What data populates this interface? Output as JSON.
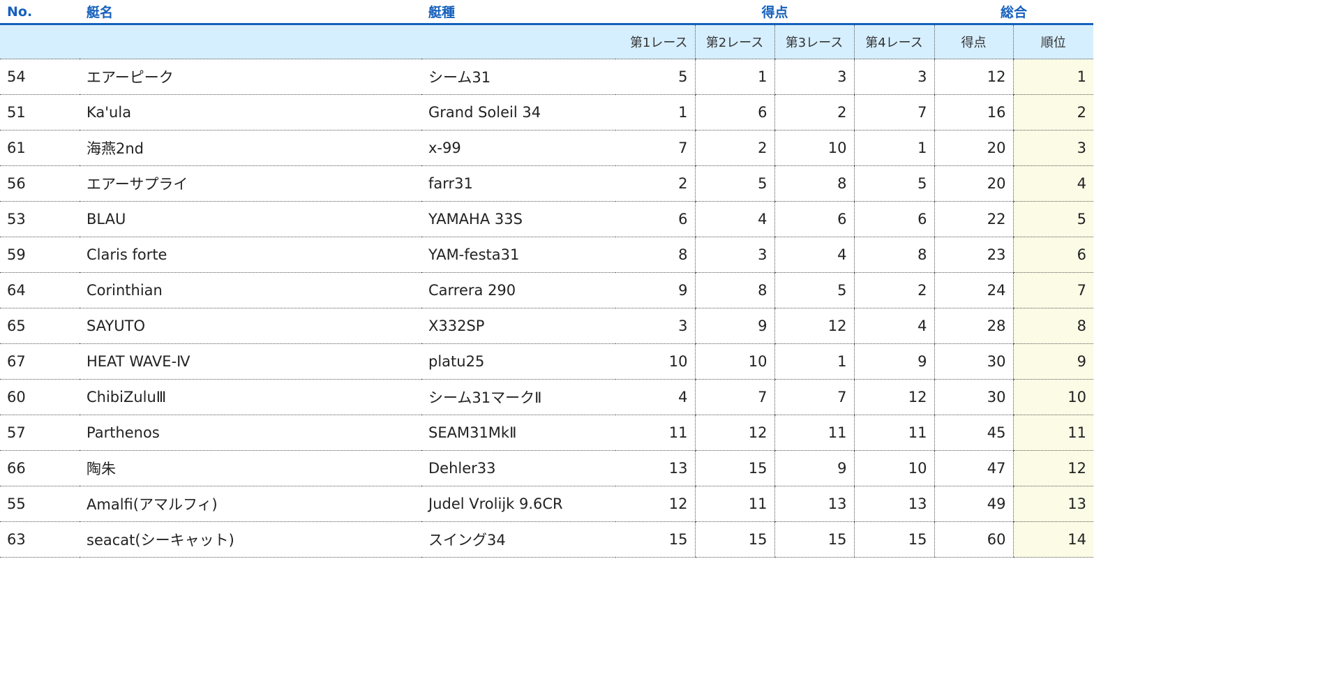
{
  "table": {
    "group_headers": {
      "no": "No.",
      "boat_name": "艇名",
      "boat_type": "艇種",
      "score": "得点",
      "overall": "総合"
    },
    "sub_headers": {
      "race1": "第1レース",
      "race2": "第2レース",
      "race3": "第3レース",
      "race4": "第4レース",
      "points": "得点",
      "rank": "順位"
    },
    "rows": [
      {
        "no": "54",
        "name": "エアーピーク",
        "type": "シーム31",
        "r1": "5",
        "r2": "1",
        "r3": "3",
        "r4": "3",
        "points": "12",
        "rank": "1"
      },
      {
        "no": "51",
        "name": "Ka'ula",
        "type": "Grand Soleil 34",
        "r1": "1",
        "r2": "6",
        "r3": "2",
        "r4": "7",
        "points": "16",
        "rank": "2"
      },
      {
        "no": "61",
        "name": "海燕2nd",
        "type": "x-99",
        "r1": "7",
        "r2": "2",
        "r3": "10",
        "r4": "1",
        "points": "20",
        "rank": "3"
      },
      {
        "no": "56",
        "name": "エアーサプライ",
        "type": "farr31",
        "r1": "2",
        "r2": "5",
        "r3": "8",
        "r4": "5",
        "points": "20",
        "rank": "4"
      },
      {
        "no": "53",
        "name": "BLAU",
        "type": "YAMAHA 33S",
        "r1": "6",
        "r2": "4",
        "r3": "6",
        "r4": "6",
        "points": "22",
        "rank": "5"
      },
      {
        "no": "59",
        "name": "Claris forte",
        "type": "YAM-festa31",
        "r1": "8",
        "r2": "3",
        "r3": "4",
        "r4": "8",
        "points": "23",
        "rank": "6"
      },
      {
        "no": "64",
        "name": "Corinthian",
        "type": "Carrera 290",
        "r1": "9",
        "r2": "8",
        "r3": "5",
        "r4": "2",
        "points": "24",
        "rank": "7"
      },
      {
        "no": "65",
        "name": "SAYUTO",
        "type": "X332SP",
        "r1": "3",
        "r2": "9",
        "r3": "12",
        "r4": "4",
        "points": "28",
        "rank": "8"
      },
      {
        "no": "67",
        "name": "HEAT WAVE-Ⅳ",
        "type": "platu25",
        "r1": "10",
        "r2": "10",
        "r3": "1",
        "r4": "9",
        "points": "30",
        "rank": "9"
      },
      {
        "no": "60",
        "name": "ChibiZuluⅢ",
        "type": "シーム31マークⅡ",
        "r1": "4",
        "r2": "7",
        "r3": "7",
        "r4": "12",
        "points": "30",
        "rank": "10"
      },
      {
        "no": "57",
        "name": "Parthenos",
        "type": "SEAM31MkⅡ",
        "r1": "11",
        "r2": "12",
        "r3": "11",
        "r4": "11",
        "points": "45",
        "rank": "11"
      },
      {
        "no": "66",
        "name": "陶朱",
        "type": "Dehler33",
        "r1": "13",
        "r2": "15",
        "r3": "9",
        "r4": "10",
        "points": "47",
        "rank": "12"
      },
      {
        "no": "55",
        "name": "Amalfi(アマルフィ)",
        "type": "Judel Vrolijk 9.6CR",
        "r1": "12",
        "r2": "11",
        "r3": "13",
        "r4": "13",
        "points": "49",
        "rank": "13"
      },
      {
        "no": "63",
        "name": "seacat(シーキャット)",
        "type": "スイング34",
        "r1": "15",
        "r2": "15",
        "r3": "15",
        "r4": "15",
        "points": "60",
        "rank": "14"
      }
    ]
  },
  "colors": {
    "header_text": "#1560bd",
    "header_rule": "#1560bd",
    "subheader_bg": "#d6efff",
    "rank_bg": "#fbfbe6"
  }
}
